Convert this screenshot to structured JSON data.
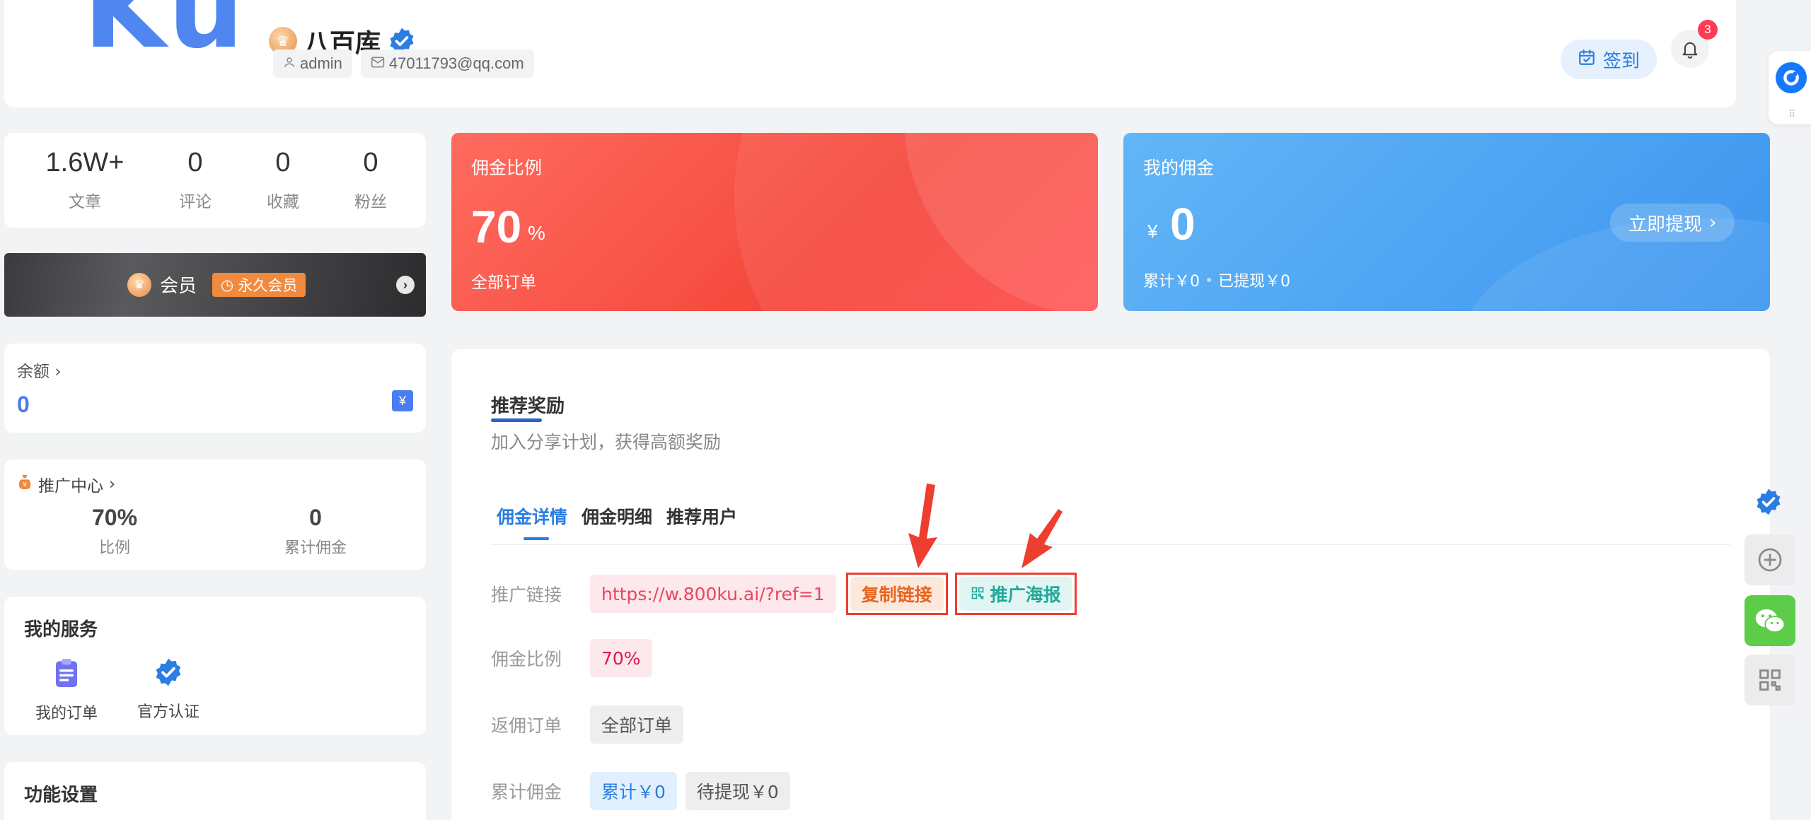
{
  "header": {
    "logo_text": "Ku",
    "username": "八百库",
    "tags": [
      {
        "icon": "user-icon",
        "text": "admin"
      },
      {
        "icon": "mail-icon",
        "text": "47011793@qq.com"
      }
    ],
    "signin_label": "签到",
    "notification_count": "3"
  },
  "stats": [
    {
      "value": "1.6W+",
      "label": "文章"
    },
    {
      "value": "0",
      "label": "评论"
    },
    {
      "value": "0",
      "label": "收藏"
    },
    {
      "value": "0",
      "label": "粉丝"
    }
  ],
  "vip": {
    "label": "会员",
    "badge": "永久会员"
  },
  "balance": {
    "label": "余额",
    "value": "0"
  },
  "promo_center": {
    "label": "推广中心",
    "ratio_value": "70%",
    "ratio_label": "比例",
    "total_value": "0",
    "total_label": "累计佣金"
  },
  "services": {
    "title": "我的服务",
    "items": [
      {
        "label": "我的订单",
        "icon": "clipboard-icon"
      },
      {
        "label": "官方认证",
        "icon": "verified-icon"
      }
    ]
  },
  "settings": {
    "title": "功能设置"
  },
  "ratio_card": {
    "title": "佣金比例",
    "value": "70",
    "unit": "%",
    "footer": "全部订单"
  },
  "commission_card": {
    "title": "我的佣金",
    "currency": "¥",
    "value": "0",
    "total": "累计￥0",
    "withdrawn": "已提现￥0",
    "withdraw_button": "立即提现"
  },
  "main_panel": {
    "title": "推荐奖励",
    "subtitle": "加入分享计划，获得高额奖励",
    "tabs": [
      {
        "label": "佣金详情",
        "active": true
      },
      {
        "label": "佣金明细",
        "active": false
      },
      {
        "label": "推荐用户",
        "active": false
      }
    ],
    "rows": {
      "link_label": "推广链接",
      "link_value": "https://w.800ku.ai/?ref=1",
      "copy_button": "复制链接",
      "poster_button": "推广海报",
      "ratio_label": "佣金比例",
      "ratio_value": "70%",
      "orders_label": "返佣订单",
      "orders_value": "全部订单",
      "total_label": "累计佣金",
      "total_value": "累计￥0",
      "pending_value": "待提现￥0"
    }
  },
  "colors": {
    "accent_blue": "#2a7de1",
    "card_red": "#f5483c",
    "card_blue": "#3d95ee",
    "annotation_red": "#ee3e2f"
  }
}
